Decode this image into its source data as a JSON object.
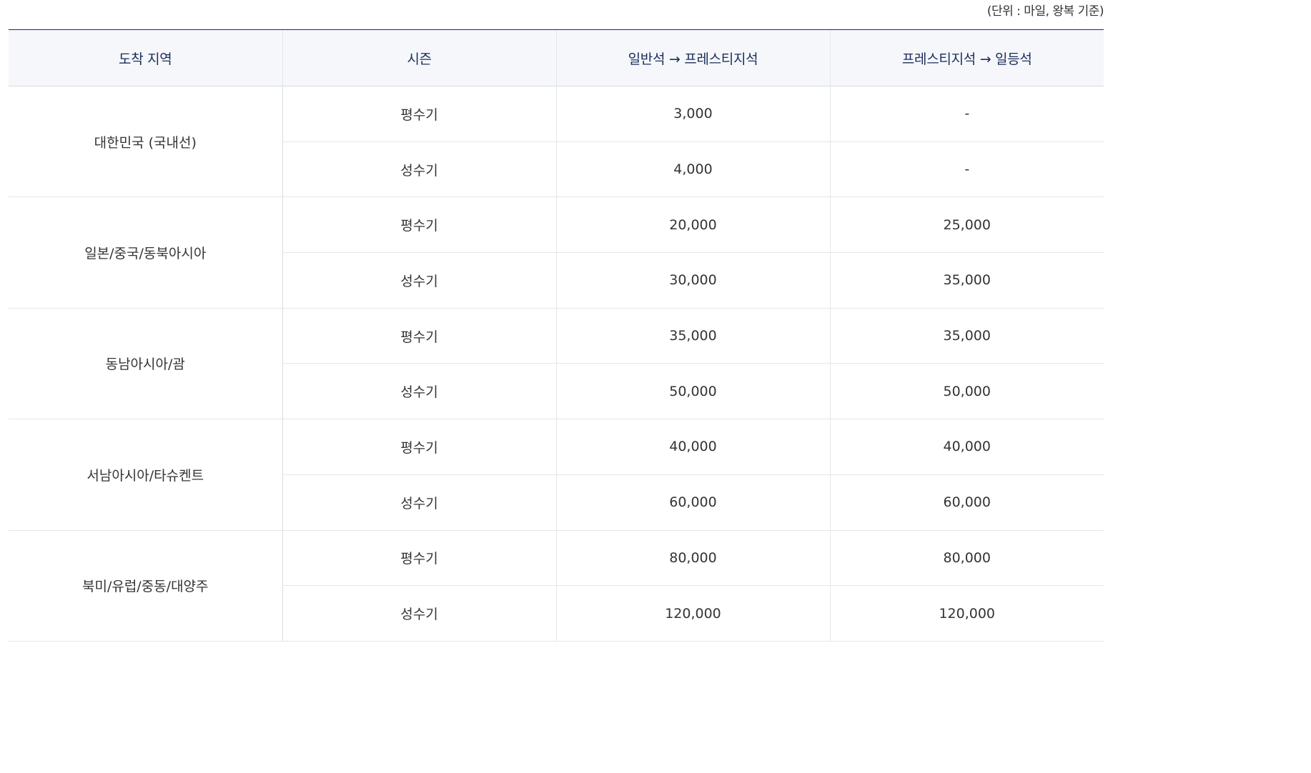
{
  "unit_note": "(단위 : 마일, 왕복 기준)",
  "headers": {
    "region": "도착 지역",
    "season": "시즌",
    "economy_to_prestige": "일반석 → 프레스티지석",
    "prestige_to_first": "프레스티지석 → 일등석"
  },
  "rows": [
    {
      "region": "대한민국 (국내선)",
      "off_peak": {
        "season": "평수기",
        "economy_to_prestige": "3,000",
        "prestige_to_first": "-"
      },
      "peak": {
        "season": "성수기",
        "economy_to_prestige": "4,000",
        "prestige_to_first": "-"
      }
    },
    {
      "region": "일본/중국/동북아시아",
      "off_peak": {
        "season": "평수기",
        "economy_to_prestige": "20,000",
        "prestige_to_first": "25,000"
      },
      "peak": {
        "season": "성수기",
        "economy_to_prestige": "30,000",
        "prestige_to_first": "35,000"
      }
    },
    {
      "region": "동남아시아/괌",
      "off_peak": {
        "season": "평수기",
        "economy_to_prestige": "35,000",
        "prestige_to_first": "35,000"
      },
      "peak": {
        "season": "성수기",
        "economy_to_prestige": "50,000",
        "prestige_to_first": "50,000"
      }
    },
    {
      "region": "서남아시아/타슈켄트",
      "off_peak": {
        "season": "평수기",
        "economy_to_prestige": "40,000",
        "prestige_to_first": "40,000"
      },
      "peak": {
        "season": "성수기",
        "economy_to_prestige": "60,000",
        "prestige_to_first": "60,000"
      }
    },
    {
      "region": "북미/유럽/중동/대양주",
      "off_peak": {
        "season": "평수기",
        "economy_to_prestige": "80,000",
        "prestige_to_first": "80,000"
      },
      "peak": {
        "season": "성수기",
        "economy_to_prestige": "120,000",
        "prestige_to_first": "120,000"
      }
    }
  ]
}
